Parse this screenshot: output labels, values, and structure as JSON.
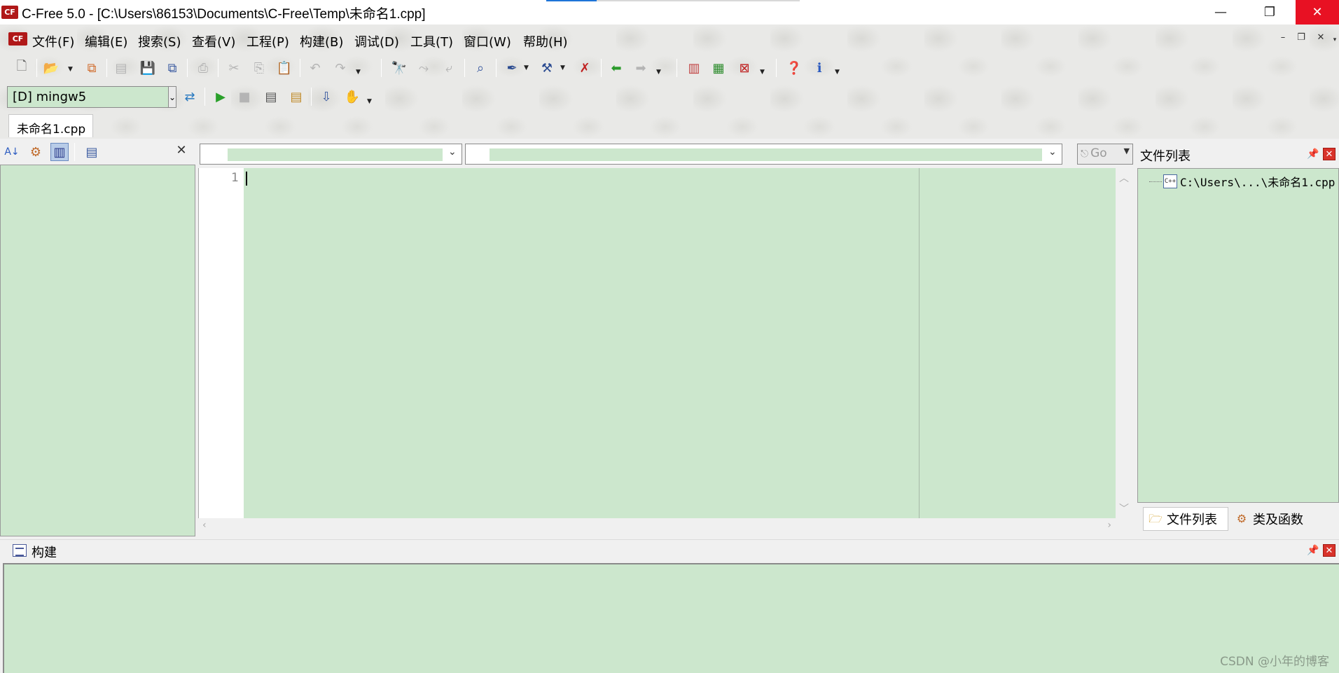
{
  "window": {
    "title": "C-Free 5.0 - [C:\\Users\\86153\\Documents\\C-Free\\Temp\\未命名1.cpp]",
    "min_icon": "minimize-icon",
    "max_icon": "restore-icon",
    "close_icon": "close-icon",
    "close_color": "#e81123"
  },
  "menu": {
    "items": [
      {
        "label": "文件(F)"
      },
      {
        "label": "编辑(E)"
      },
      {
        "label": "搜索(S)"
      },
      {
        "label": "查看(V)"
      },
      {
        "label": "工程(P)"
      },
      {
        "label": "构建(B)"
      },
      {
        "label": "调试(D)"
      },
      {
        "label": "工具(T)"
      },
      {
        "label": "窗口(W)"
      },
      {
        "label": "帮助(H)"
      }
    ]
  },
  "toolbar": {
    "compiler": "[D] mingw5"
  },
  "tabs": {
    "document": "未命名1.cpp"
  },
  "editor": {
    "go_label": "Go",
    "line_numbers": [
      "1"
    ],
    "background_color": "#cce7cd"
  },
  "file_panel": {
    "title": "文件列表",
    "tree_item": "C:\\Users\\...\\未命名1.cpp",
    "tabs": [
      {
        "label": "文件列表"
      },
      {
        "label": "类及函数"
      }
    ]
  },
  "build_panel": {
    "title": "构建"
  },
  "watermark": "CSDN @小年的博客"
}
